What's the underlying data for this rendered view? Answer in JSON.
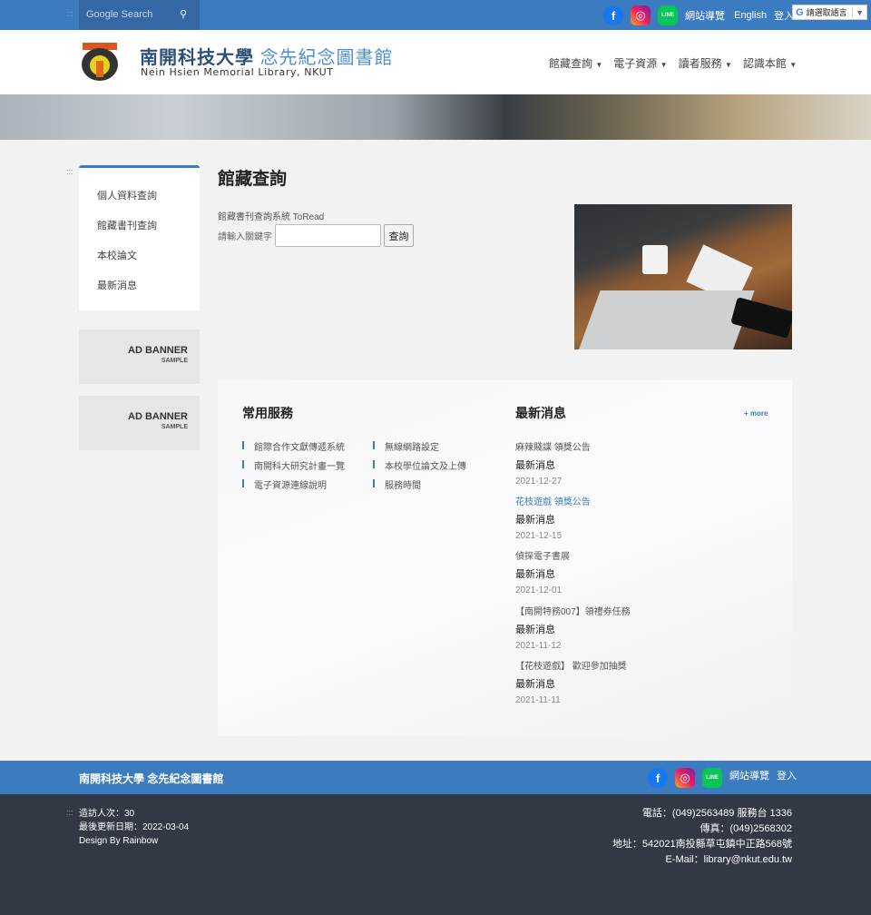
{
  "topbar": {
    "search_placeholder": "Google Search",
    "sitemap": "網站導覽",
    "english": "English",
    "login": "登入",
    "translate": "請選取語言"
  },
  "header": {
    "title_cn_1": "南開科技大學",
    "title_cn_2": "念先紀念圖書館",
    "title_en": "Nein Hsien Memorial Library, NKUT",
    "nav": [
      "館藏查詢",
      "電子資源",
      "讀者服務",
      "認識本館"
    ]
  },
  "sidebar": {
    "marker": ":::",
    "items": [
      "個人資料查詢",
      "館藏書刊查詢",
      "本校論文",
      "最新消息"
    ],
    "ads": [
      {
        "title": "AD BANNER",
        "sub": "SAMPLE"
      },
      {
        "title": "AD BANNER",
        "sub": "SAMPLE"
      }
    ]
  },
  "main": {
    "title": "館藏查詢",
    "system": "館藏書刊查詢系統 ToRead",
    "keyword_label": "請輸入關鍵字",
    "keyword_value": "",
    "search_button": "查詢"
  },
  "services": {
    "title": "常用服務",
    "items": [
      "館際合作文獻傳遞系統",
      "無線網路設定",
      "南開科大研究計畫一覽",
      "本校學位論文及上傳",
      "電子資源連線說明",
      "服務時間"
    ]
  },
  "news": {
    "title": "最新消息",
    "more": "+ more",
    "items": [
      {
        "title": "麻辣賤諜 領獎公告",
        "category": "最新消息",
        "date": "2021-12-27"
      },
      {
        "title": "花枝遊戲 領獎公告",
        "category": "最新消息",
        "date": "2021-12-15",
        "highlight": true
      },
      {
        "title": "偵探電子書展",
        "category": "最新消息",
        "date": "2021-12-01"
      },
      {
        "title": "【南開特務007】領禮券任務",
        "category": "最新消息",
        "date": "2021-11-12"
      },
      {
        "title": "【花枝遊戲】 歡迎參加抽獎",
        "category": "最新消息",
        "date": "2021-11-11"
      }
    ]
  },
  "footer": {
    "name": "南開科技大學 念先紀念圖書館",
    "sitemap": "網站導覽",
    "login": "登入",
    "marker": ":::",
    "visits": "造訪人次：30",
    "updated": "最後更新日期：2022-03-04",
    "design": "Design By Rainbow",
    "phone": "電話：(049)2563489 服務台 1336",
    "fax": "傳真：(049)2568302",
    "address": "地址：542021南投縣草屯鎮中正路568號",
    "email": "E-Mail：library@nkut.edu.tw"
  },
  "colors": {
    "primary": "#3b7bbf",
    "footer_dark": "#323844",
    "link": "#3b7bbf"
  }
}
